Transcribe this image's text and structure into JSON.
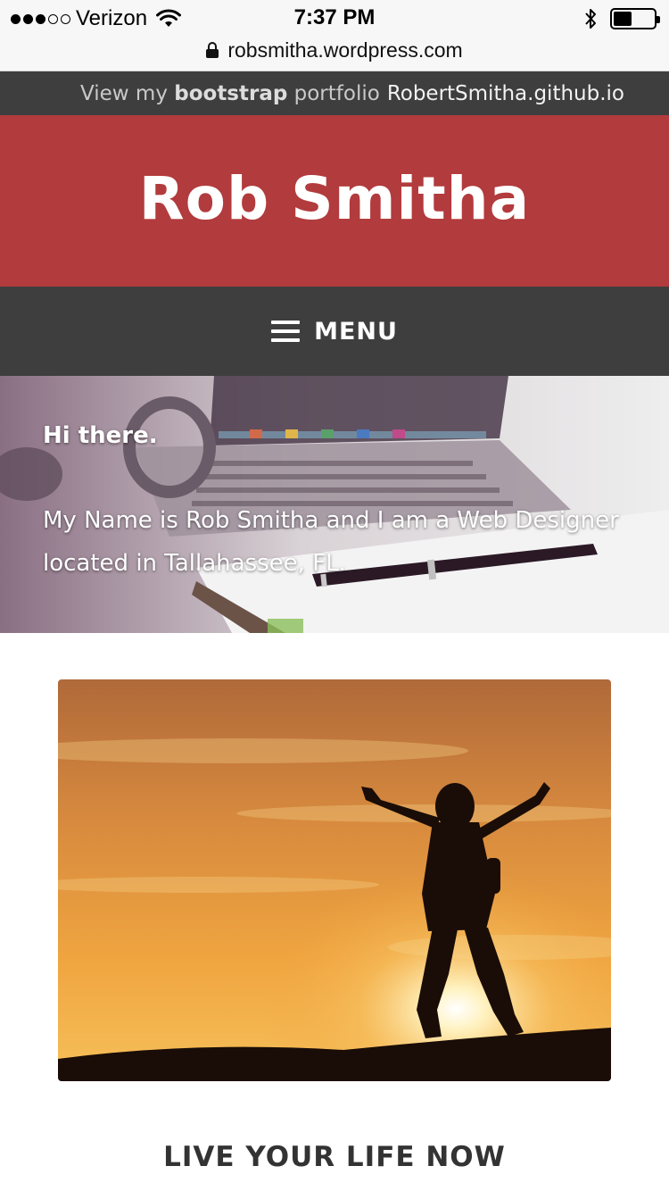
{
  "status_bar": {
    "carrier": "Verizon",
    "time": "7:37 PM",
    "signal_bars_filled": 3,
    "signal_bars_total": 5,
    "battery_level": 0.45,
    "icons": [
      "wifi-icon",
      "bluetooth-icon",
      "battery-icon",
      "lock-icon"
    ]
  },
  "browser": {
    "url": "robsmitha.wordpress.com"
  },
  "top_strip": {
    "prefix": "View my ",
    "emphasis": "bootstrap",
    "middle": " portfolio",
    "link": "RobertSmitha.github.io"
  },
  "header": {
    "site_title": "Rob Smitha",
    "color": "#b23b3d"
  },
  "nav": {
    "menu_label": "MENU",
    "icon": "hamburger-icon",
    "background": "#3e3e3e"
  },
  "hero": {
    "greeting": "Hi there.",
    "intro": "My Name is Rob Smitha and I am a Web Designer located in Tallahassee, FL."
  },
  "feature": {
    "image": "sunset-silhouette-photo"
  },
  "section": {
    "title": "LIVE YOUR LIFE NOW"
  }
}
